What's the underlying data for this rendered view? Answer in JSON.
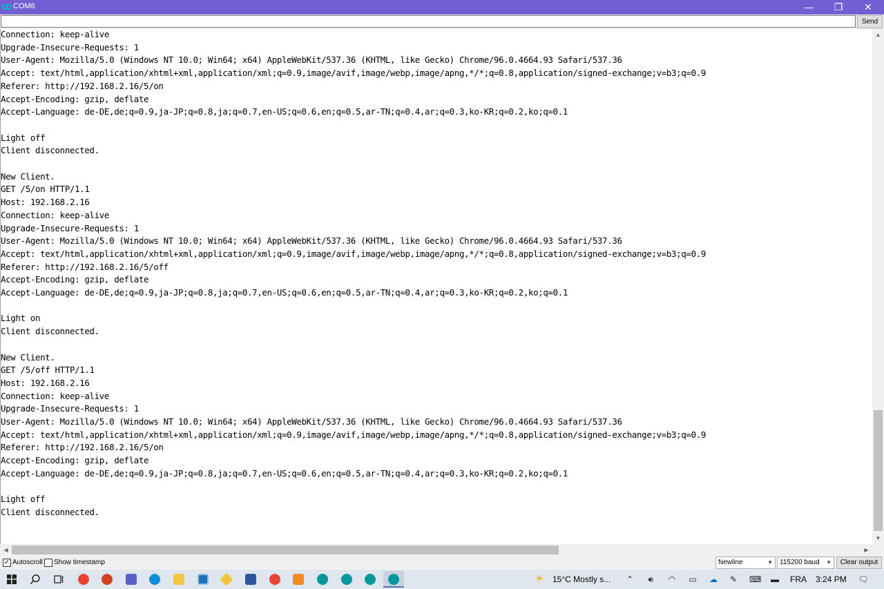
{
  "window": {
    "title": "COM6",
    "minimize": "—",
    "restore": "❐",
    "close": "✕"
  },
  "input": {
    "value": "",
    "send_label": "Send"
  },
  "log": [
    "Connection: keep-alive",
    "Upgrade-Insecure-Requests: 1",
    "User-Agent: Mozilla/5.0 (Windows NT 10.0; Win64; x64) AppleWebKit/537.36 (KHTML, like Gecko) Chrome/96.0.4664.93 Safari/537.36",
    "Accept: text/html,application/xhtml+xml,application/xml;q=0.9,image/avif,image/webp,image/apng,*/*;q=0.8,application/signed-exchange;v=b3;q=0.9",
    "Referer: http://192.168.2.16/5/on",
    "Accept-Encoding: gzip, deflate",
    "Accept-Language: de-DE,de;q=0.9,ja-JP;q=0.8,ja;q=0.7,en-US;q=0.6,en;q=0.5,ar-TN;q=0.4,ar;q=0.3,ko-KR;q=0.2,ko;q=0.1",
    "",
    "Light off",
    "Client disconnected.",
    "",
    "New Client.",
    "GET /5/on HTTP/1.1",
    "Host: 192.168.2.16",
    "Connection: keep-alive",
    "Upgrade-Insecure-Requests: 1",
    "User-Agent: Mozilla/5.0 (Windows NT 10.0; Win64; x64) AppleWebKit/537.36 (KHTML, like Gecko) Chrome/96.0.4664.93 Safari/537.36",
    "Accept: text/html,application/xhtml+xml,application/xml;q=0.9,image/avif,image/webp,image/apng,*/*;q=0.8,application/signed-exchange;v=b3;q=0.9",
    "Referer: http://192.168.2.16/5/off",
    "Accept-Encoding: gzip, deflate",
    "Accept-Language: de-DE,de;q=0.9,ja-JP;q=0.8,ja;q=0.7,en-US;q=0.6,en;q=0.5,ar-TN;q=0.4,ar;q=0.3,ko-KR;q=0.2,ko;q=0.1",
    "",
    "Light on",
    "Client disconnected.",
    "",
    "New Client.",
    "GET /5/off HTTP/1.1",
    "Host: 192.168.2.16",
    "Connection: keep-alive",
    "Upgrade-Insecure-Requests: 1",
    "User-Agent: Mozilla/5.0 (Windows NT 10.0; Win64; x64) AppleWebKit/537.36 (KHTML, like Gecko) Chrome/96.0.4664.93 Safari/537.36",
    "Accept: text/html,application/xhtml+xml,application/xml;q=0.9,image/avif,image/webp,image/apng,*/*;q=0.8,application/signed-exchange;v=b3;q=0.9",
    "Referer: http://192.168.2.16/5/on",
    "Accept-Encoding: gzip, deflate",
    "Accept-Language: de-DE,de;q=0.9,ja-JP;q=0.8,ja;q=0.7,en-US;q=0.6,en;q=0.5,ar-TN;q=0.4,ar;q=0.3,ko-KR;q=0.2,ko;q=0.1",
    "",
    "Light off",
    "Client disconnected."
  ],
  "bottombar": {
    "autoscroll_label": "Autoscroll",
    "autoscroll_checked": true,
    "timestamp_label": "Show timestamp",
    "timestamp_checked": false,
    "line_ending": "Newline",
    "baud": "115200 baud",
    "clear_label": "Clear output"
  },
  "taskbar": {
    "weather": "15°C  Mostly s...",
    "language": "FRA",
    "time": "3:24 PM",
    "colors": {
      "chrome": "#e84335",
      "powerpoint": "#d04423",
      "teams": "#5b5fc7",
      "edge": "#0f8fd8",
      "explorer": "#f4c542",
      "word": "#2b579a",
      "arduino": "#00979d",
      "eclipse": "#f28a1f"
    }
  }
}
